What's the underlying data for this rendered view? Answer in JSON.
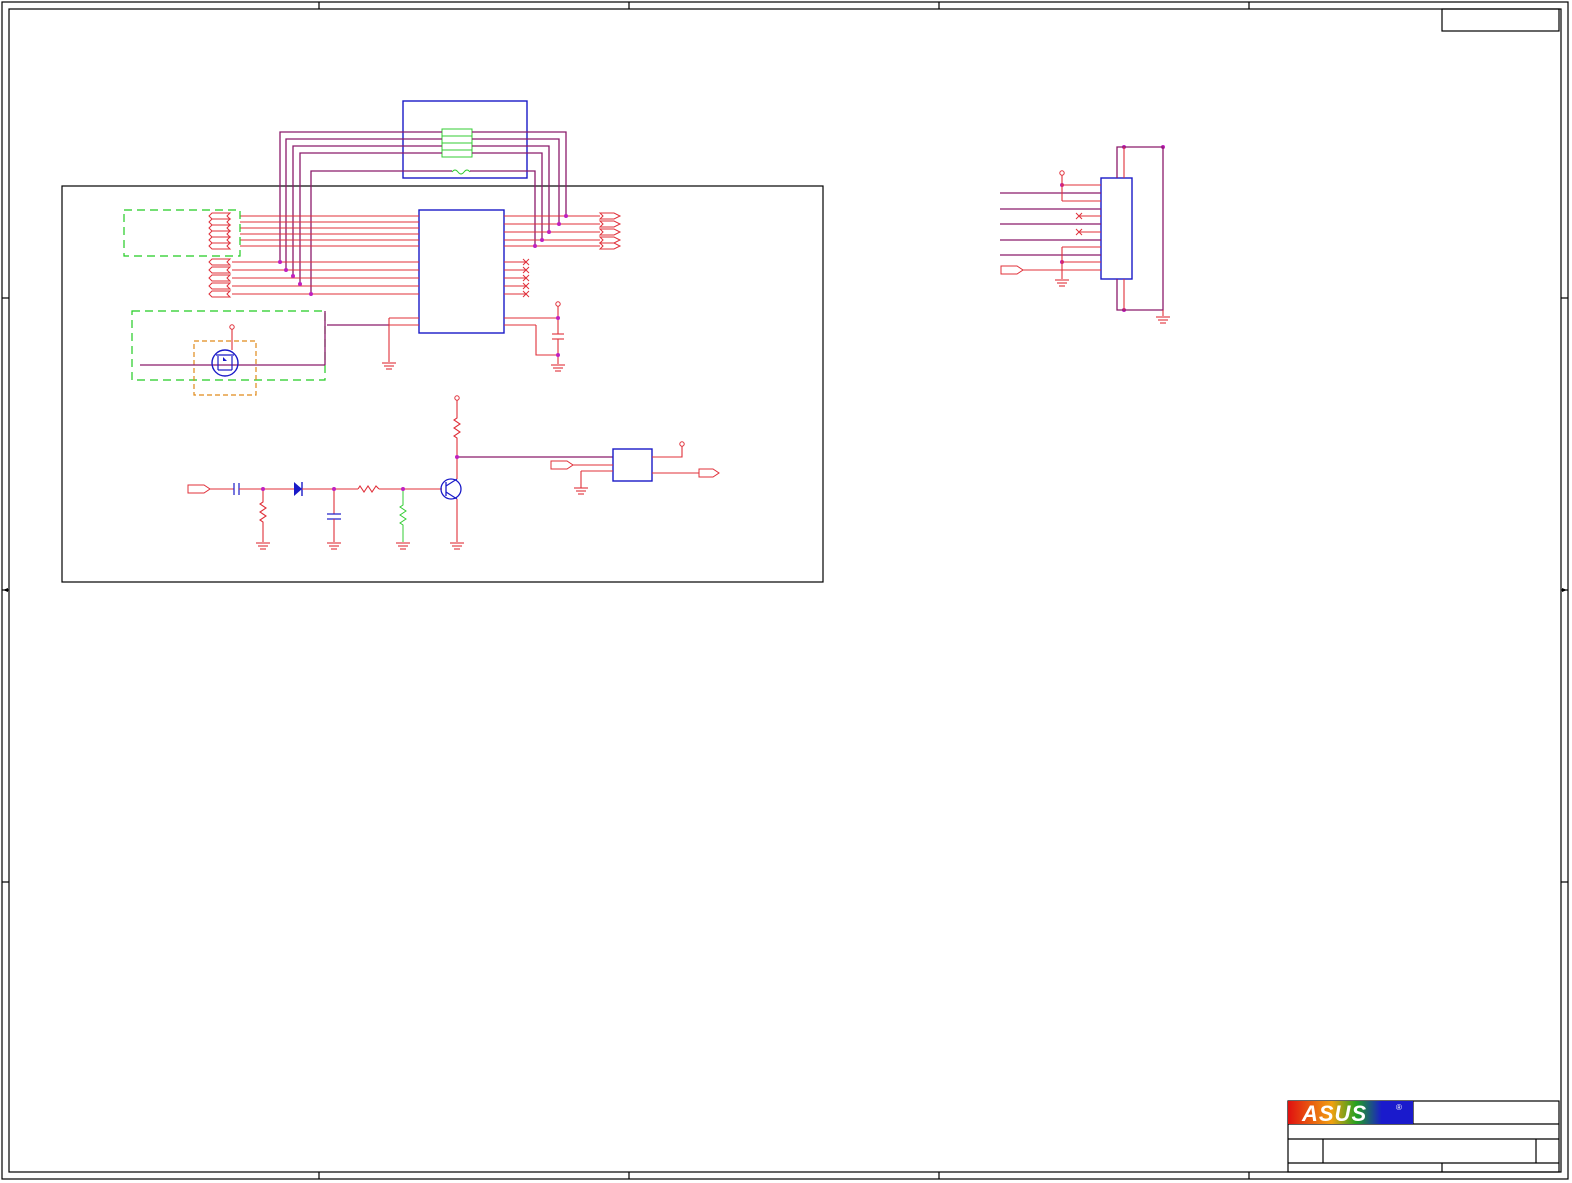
{
  "title_block": {
    "logo_text": "ASUS",
    "registered_mark": "®"
  },
  "colors": {
    "wire": "#8b1a6b",
    "pin": "#e0303a",
    "component": "#1a1ac8",
    "group_outline": "#22cc22",
    "sub_outline": "#e08a1a",
    "junction": "#c020c0",
    "logo_blue": "#1a1acc",
    "logo_red": "#e01010"
  }
}
